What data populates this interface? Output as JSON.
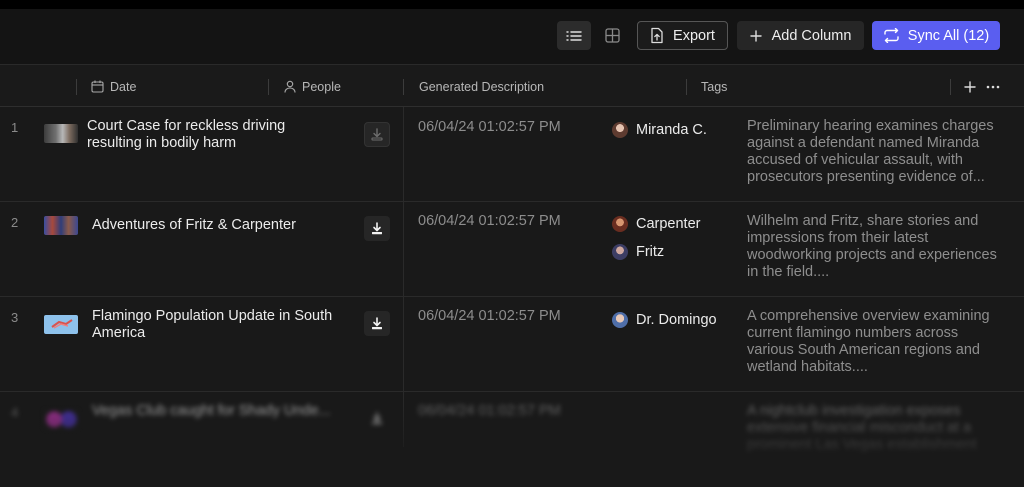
{
  "toolbar": {
    "export_label": "Export",
    "add_column_label": "Add Column",
    "sync_label": "Sync All (12)",
    "accent": "#5a5ef0"
  },
  "header": {
    "date": "Date",
    "people": "People",
    "generated_description": "Generated Description",
    "tags": "Tags"
  },
  "rows": [
    {
      "num": "1",
      "title": "Court Case for reckless driving resulting in bodily harm",
      "date": "06/04/24 01:02:57 PM",
      "people": [
        "Miranda C."
      ],
      "description": "Preliminary hearing examines charges against a defendant named Miranda accused of vehicular assault, with prosecutors presenting evidence of..."
    },
    {
      "num": "2",
      "title": "Adventures of Fritz & Carpenter",
      "date": "06/04/24 01:02:57 PM",
      "people": [
        "Carpenter",
        "Fritz"
      ],
      "description": "Wilhelm and Fritz, share stories and impressions from their latest woodworking projects and experiences in the field...."
    },
    {
      "num": "3",
      "title": "Flamingo Population Update in South America",
      "date": "06/04/24 01:02:57 PM",
      "people": [
        "Dr. Domingo"
      ],
      "description": "A comprehensive overview examining current flamingo numbers across various South American regions and wetland habitats...."
    },
    {
      "num": "4",
      "title": "Vegas Club caught for Shady Unde...",
      "date": "06/04/24 01:02:57 PM",
      "people": [],
      "description": "A nightclub investigation exposes extensive financial misconduct at a prominent Las Vegas establishment"
    }
  ]
}
